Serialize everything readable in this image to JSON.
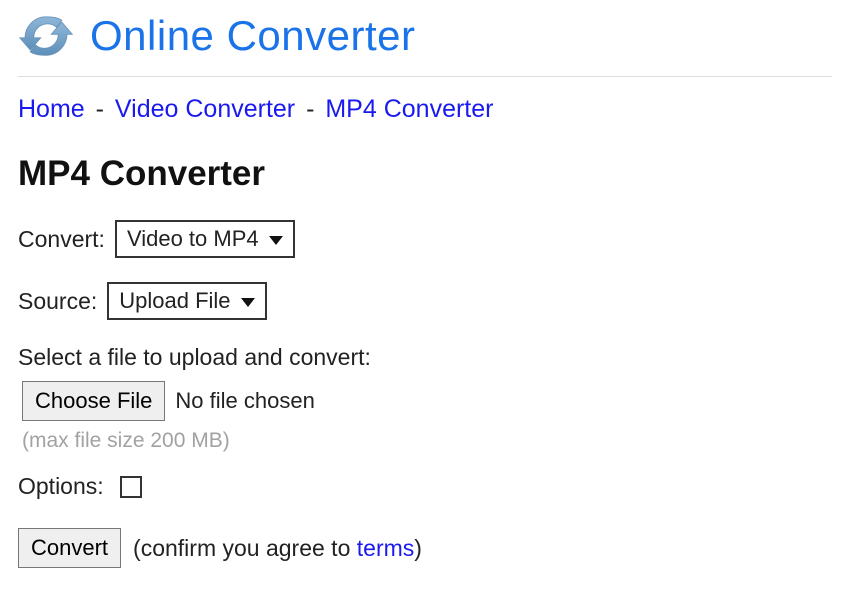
{
  "header": {
    "site_title": "Online Converter"
  },
  "breadcrumb": {
    "items": [
      {
        "label": "Home"
      },
      {
        "label": "Video Converter"
      },
      {
        "label": "MP4 Converter"
      }
    ],
    "separator": "-"
  },
  "page": {
    "title": "MP4 Converter"
  },
  "form": {
    "convert_label": "Convert:",
    "convert_value": "Video to MP4",
    "source_label": "Source:",
    "source_value": "Upload File",
    "file_select_label": "Select a file to upload and convert:",
    "choose_file_label": "Choose File",
    "file_status": "No file chosen",
    "max_size_hint": "(max file size 200 MB)",
    "options_label": "Options:",
    "convert_button": "Convert",
    "confirm_prefix": "(confirm you agree to ",
    "terms_label": "terms",
    "confirm_suffix": ")"
  }
}
